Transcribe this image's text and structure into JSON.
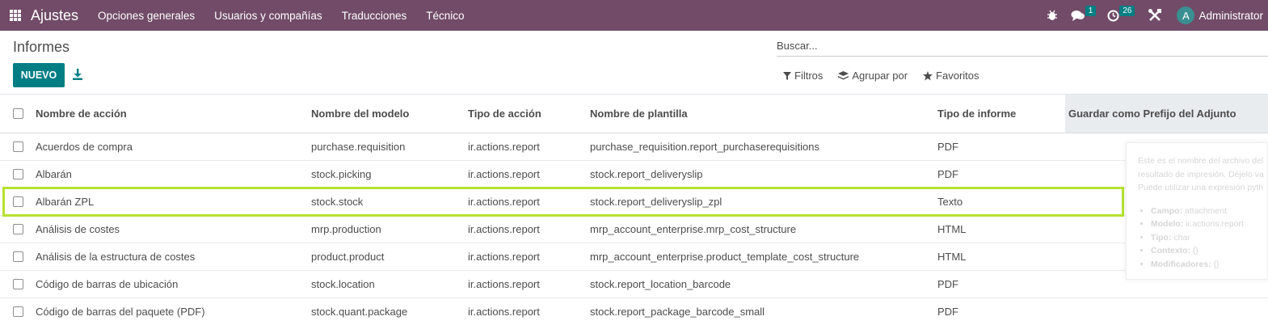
{
  "navbar": {
    "app_name": "Ajustes",
    "menu": [
      "Opciones generales",
      "Usuarios y compañías",
      "Traducciones",
      "Técnico"
    ],
    "messages_count": "1",
    "activities_count": "26",
    "avatar_letter": "A",
    "user_name": "Administrator"
  },
  "page": {
    "title": "Informes",
    "new_button": "NUEVO"
  },
  "search": {
    "placeholder": "Buscar..."
  },
  "filters": {
    "filters_label": "Filtros",
    "group_by_label": "Agrupar por",
    "favorites_label": "Favoritos"
  },
  "table": {
    "headers": {
      "action_name": "Nombre de acción",
      "model_name": "Nombre del modelo",
      "action_type": "Tipo de acción",
      "template_name": "Nombre de plantilla",
      "report_type": "Tipo de informe",
      "attachment_prefix": "Guardar como Prefijo del Adjunto"
    },
    "rows": [
      {
        "action_name": "Acuerdos de compra",
        "model_name": "purchase.requisition",
        "action_type": "ir.actions.report",
        "template_name": "purchase_requisition.report_purchaserequisitions",
        "report_type": "PDF"
      },
      {
        "action_name": "Albarán",
        "model_name": "stock.picking",
        "action_type": "ir.actions.report",
        "template_name": "stock.report_deliveryslip",
        "report_type": "PDF"
      },
      {
        "action_name": "Albarán ZPL",
        "model_name": "stock.stock",
        "action_type": "ir.actions.report",
        "template_name": "stock.report_deliveryslip_zpl",
        "report_type": "Texto"
      },
      {
        "action_name": "Análisis de costes",
        "model_name": "mrp.production",
        "action_type": "ir.actions.report",
        "template_name": "mrp_account_enterprise.mrp_cost_structure",
        "report_type": "HTML"
      },
      {
        "action_name": "Análisis de la estructura de costes",
        "model_name": "product.product",
        "action_type": "ir.actions.report",
        "template_name": "mrp_account_enterprise.product_template_cost_structure",
        "report_type": "HTML"
      },
      {
        "action_name": "Código de barras de ubicación",
        "model_name": "stock.location",
        "action_type": "ir.actions.report",
        "template_name": "stock.report_location_barcode",
        "report_type": "PDF"
      },
      {
        "action_name": "Código de barras del paquete (PDF)",
        "model_name": "stock.quant.package",
        "action_type": "ir.actions.report",
        "template_name": "stock.report_package_barcode_small",
        "report_type": "PDF"
      }
    ]
  },
  "tooltip": {
    "line1": "Este es el nombre del archivo del",
    "line2": "resultado de impresión. Déjelo va",
    "line3": "Puede utilizar una expresión pyth",
    "field_label": "Campo:",
    "field_value": "attachment",
    "model_label": "Modelo:",
    "model_value": "ir.actions.report",
    "type_label": "Tipo:",
    "type_value": "char",
    "context_label": "Contexto:",
    "context_value": "{}",
    "modifiers_label": "Modificadores:",
    "modifiers_value": "{}"
  },
  "colors": {
    "navbar": "#714b67",
    "primary": "#017e84",
    "highlight": "#b5e22e"
  }
}
